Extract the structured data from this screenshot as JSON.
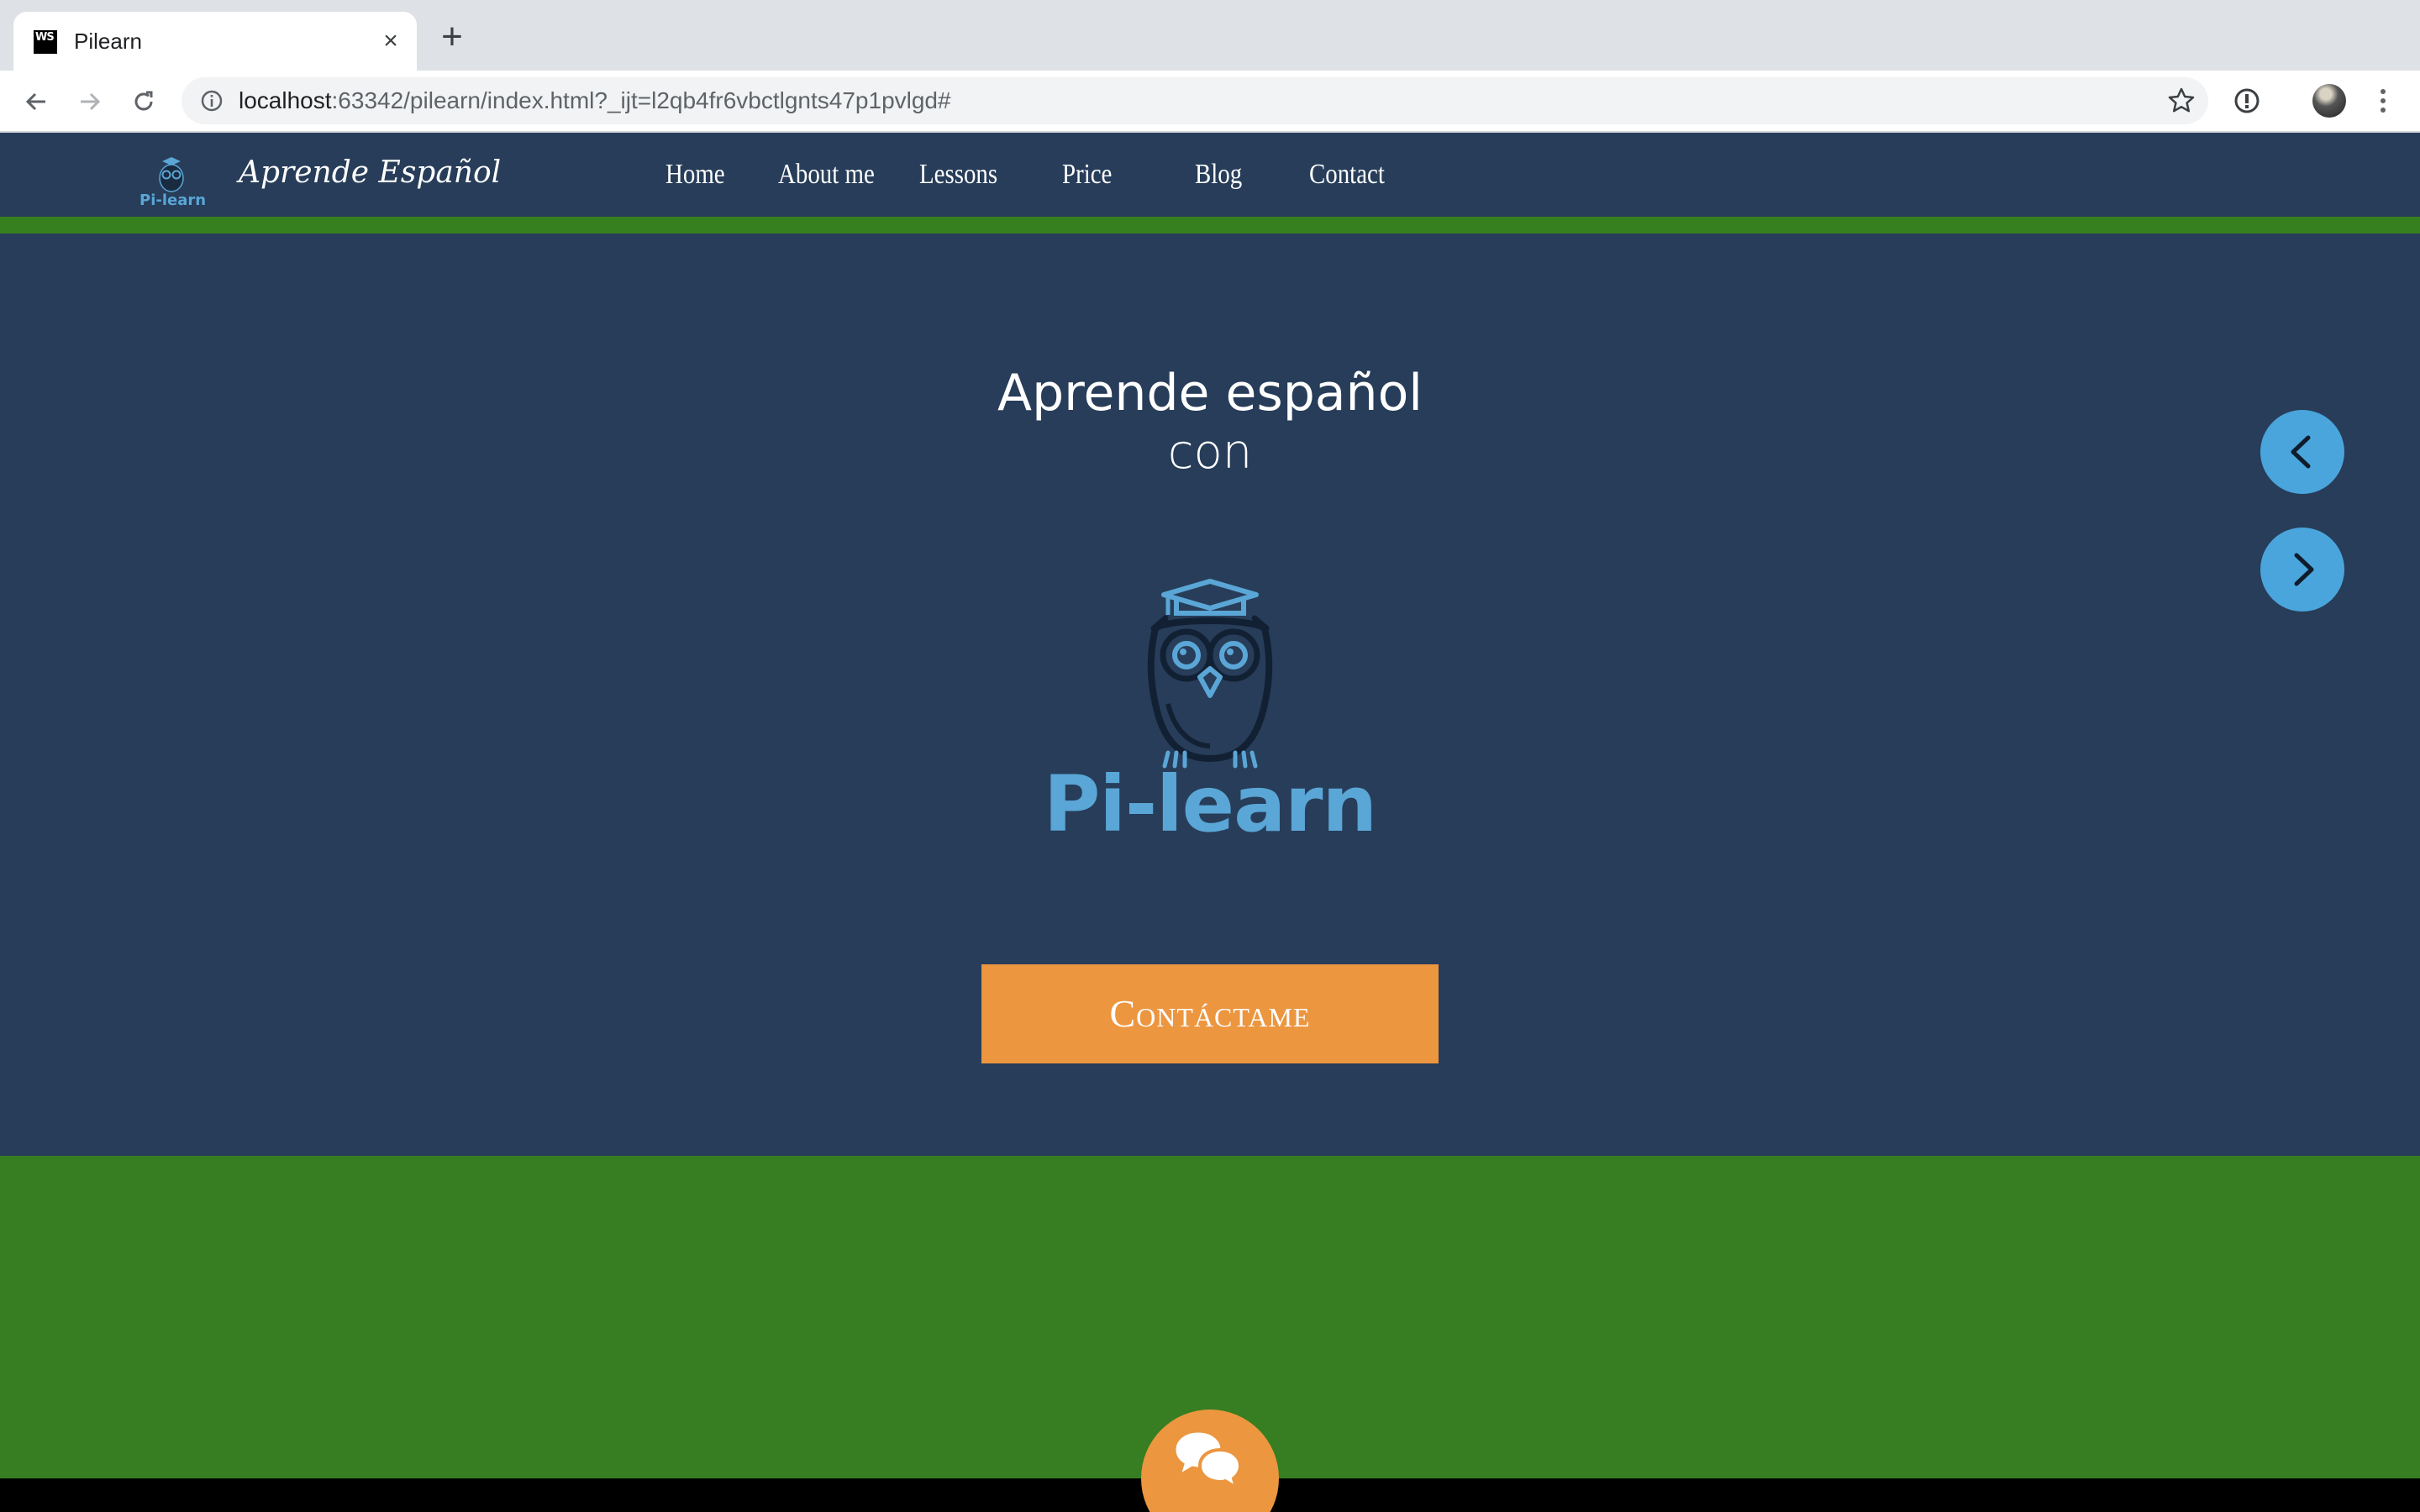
{
  "browser": {
    "tab_title": "Pilearn",
    "favicon_text": "WS",
    "close_icon": "×",
    "new_tab_icon": "+",
    "url_host": "localhost",
    "url_rest": ":63342/pilearn/index.html?_ijt=l2qb4fr6vbctlgnts47p1pvlgd#"
  },
  "header": {
    "logo_text": "Pi-learn",
    "brand": "Aprende Español",
    "nav": [
      "Home",
      "About me",
      "Lessons",
      "Price",
      "Blog",
      "Contact"
    ]
  },
  "hero": {
    "title": "Aprende español",
    "subtitle": "con",
    "logo_wordmark": "Pi-learn",
    "cta_label": "Contáctame"
  },
  "colors": {
    "header_bg": "#273d59",
    "accent_green": "#37801f",
    "cta_orange": "#ec9640",
    "slider_blue": "#4aa5dc",
    "logo_blue": "#5aa6d6"
  },
  "icons": {
    "prev": "chevron-left-icon",
    "next": "chevron-right-icon",
    "chat": "chat-bubbles-icon"
  }
}
